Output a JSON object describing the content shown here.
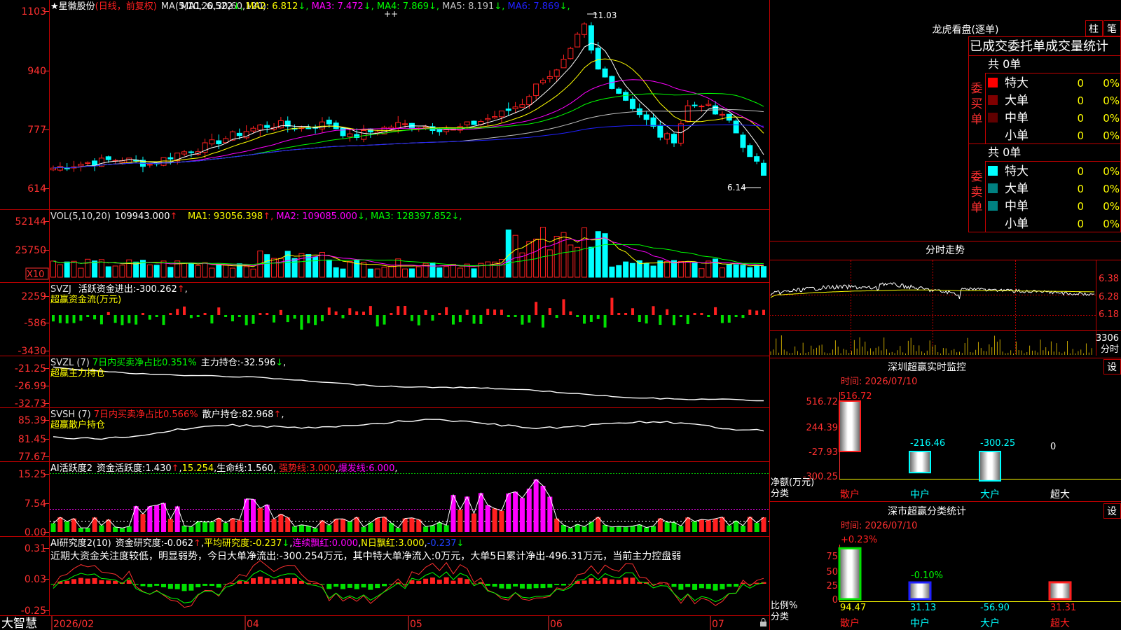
{
  "app": {
    "brand": "大智慧"
  },
  "colors": {
    "up": "#ff2020",
    "down": "#00ffff",
    "ma1": "#ffffff",
    "ma2": "#ffff00",
    "ma3": "#ff00ff",
    "ma4": "#00ff00",
    "ma5": "#c0c0c0",
    "ma6": "#2020ff",
    "green": "#00e000",
    "magenta": "#ff00ff",
    "grid": "#c00000",
    "axis": "#ff3030"
  },
  "main": {
    "header": {
      "star": "★",
      "name": "星徽股份",
      "mode": "(日线，前复权)",
      "ma_spec": "MA(5,10,20,30,60,120)",
      "items": [
        {
          "label": "MA1:",
          "value": "6.522",
          "arrow": "↓"
        },
        {
          "label": "MA2:",
          "value": "6.812",
          "arrow": "↓"
        },
        {
          "label": "MA3:",
          "value": "7.472",
          "arrow": "↓"
        },
        {
          "label": "MA4:",
          "value": "7.869",
          "arrow": "↓"
        },
        {
          "label": "MA5:",
          "value": "8.191",
          "arrow": "↓"
        },
        {
          "label": "MA6:",
          "value": "7.869",
          "arrow": "↓"
        }
      ]
    },
    "y_ticks": [
      "1103",
      "940",
      "777",
      "614"
    ],
    "high_label": "11.03",
    "low_label": "6.14",
    "marks": "++"
  },
  "vol": {
    "header": {
      "spec": "VOL(5,10,20)",
      "value": "109943.000",
      "arrow": "↑",
      "items": [
        {
          "label": "MA1:",
          "value": "93056.398",
          "arrow": "↑"
        },
        {
          "label": "MA2:",
          "value": "109085.000",
          "arrow": "↓"
        },
        {
          "label": "MA3:",
          "value": "128397.852",
          "arrow": "↓"
        }
      ]
    },
    "y_ticks": [
      "52144",
      "25750"
    ],
    "unit": "X10"
  },
  "svzj": {
    "header": {
      "spec": "SVZJ",
      "label": "活跃资金进出:",
      "value": "-300.262",
      "arrow": "↑",
      "tail": ","
    },
    "title": "超赢资金流(万元)",
    "y_ticks": [
      "2259",
      "-586",
      "-3430"
    ]
  },
  "svzl": {
    "header": {
      "spec": "SVZL (7)",
      "ratio": "7日内买卖净占比0.351%",
      "label": "主力持仓:",
      "value": "-32.596",
      "arrow": "↓",
      "tail": ","
    },
    "title": "超赢主力持仓",
    "y_ticks": [
      "-21.25",
      "-26.99",
      "-32.73"
    ]
  },
  "svsh": {
    "header": {
      "spec": "SVSH (7)",
      "ratio": "7日内买卖净占比0.566%",
      "label": "散户持仓:",
      "value": "82.968",
      "arrow": "↑",
      "tail": ","
    },
    "title": "超赢散户持仓",
    "y_ticks": [
      "85.39",
      "81.45",
      "77.67"
    ]
  },
  "ai1": {
    "header": {
      "spec": "AI活跃度2",
      "label": "资金活跃度:",
      "value": "1.430",
      "arrow": "↑",
      "v2": "15.254",
      "life_label": "生命线:",
      "life": "1.560",
      "strong_label": "强势线:",
      "strong": "3.000",
      "burst_label": "爆发线:",
      "burst": "6.000",
      "tail": ","
    },
    "y_ticks": [
      "15.25",
      "7.54",
      "0.00"
    ]
  },
  "ai2": {
    "header": {
      "spec": "AI研究度2(10)",
      "label": "资金研究度:",
      "value": "-0.062",
      "arrow": "↑",
      "avg_label": "平均研究度:",
      "avg": "-0.237",
      "avg_arrow": "↓",
      "red_label": "连续飘红:",
      "red": "0.000",
      "n_label": "N日飘红:",
      "n": "3.000",
      "last": "-0.237",
      "last_arrow": "↓"
    },
    "note": "近期大资金关注度较低，明显弱势，今日大单净流出:-300.254万元，其中特大单净流入:0万元，大单5日累计净出-496.31万元，当前主力控盘弱",
    "y_ticks": [
      "0.31",
      "0.03",
      "-0.25"
    ]
  },
  "x_axis": [
    "2026/02",
    "04",
    "05",
    "06",
    "07"
  ],
  "lhb": {
    "title": "龙虎看盘(逐单)",
    "btn1": "柱",
    "btn2": "笔",
    "subtitle": "已成交委托单成交量统计",
    "buy": {
      "side": "委买单",
      "total": "共 0单",
      "rows": [
        {
          "name": "特大",
          "count": "0",
          "pct": "0%",
          "color": "#ff0000"
        },
        {
          "name": "大单",
          "count": "0",
          "pct": "0%",
          "color": "#800000"
        },
        {
          "name": "中单",
          "count": "0",
          "pct": "0%",
          "color": "#600000"
        },
        {
          "name": "小单",
          "count": "0",
          "pct": "0%",
          "color": ""
        }
      ]
    },
    "sell": {
      "side": "委卖单",
      "total": "共 0单",
      "rows": [
        {
          "name": "特大",
          "count": "0",
          "pct": "0%",
          "color": "#00ffff"
        },
        {
          "name": "大单",
          "count": "0",
          "pct": "0%",
          "color": "#008080"
        },
        {
          "name": "中单",
          "count": "0",
          "pct": "0%",
          "color": "#008080"
        },
        {
          "name": "小单",
          "count": "0",
          "pct": "0%",
          "color": ""
        }
      ]
    }
  },
  "intraday": {
    "title": "分时走势",
    "y_ticks": [
      "6.38",
      "6.28",
      "6.18"
    ],
    "vol_tick": "3306",
    "vol_label": "分时"
  },
  "monitor": {
    "title": "深圳超赢实时监控",
    "btn": "设",
    "time": "时间: 2026/07/10",
    "y_ticks": [
      "516.72",
      "244.39",
      "-27.93",
      "-300.25"
    ],
    "unit1": "净额(万元)",
    "unit2": "分类",
    "categories": [
      "散户",
      "中户",
      "大户",
      "超大"
    ],
    "values": [
      516.72,
      -216.46,
      -300.25,
      0
    ],
    "labels": [
      "516.72",
      "-216.46",
      "-300.25",
      "0"
    ]
  },
  "classify": {
    "title": "深市超赢分类统计",
    "btn": "设",
    "time": "时间: 2026/07/10",
    "top_label": "+0.23%",
    "mid_label": "-0.10%",
    "y_ticks": [
      "75",
      "50",
      "25",
      "0"
    ],
    "unit1": "比例%",
    "unit2": "分类",
    "categories": [
      "散户",
      "中户",
      "大户",
      "超大"
    ],
    "values": [
      94.47,
      31.13,
      -56.9,
      31.31
    ],
    "labels": [
      "94.47",
      "31.13",
      "-56.90",
      "31.31"
    ]
  }
}
